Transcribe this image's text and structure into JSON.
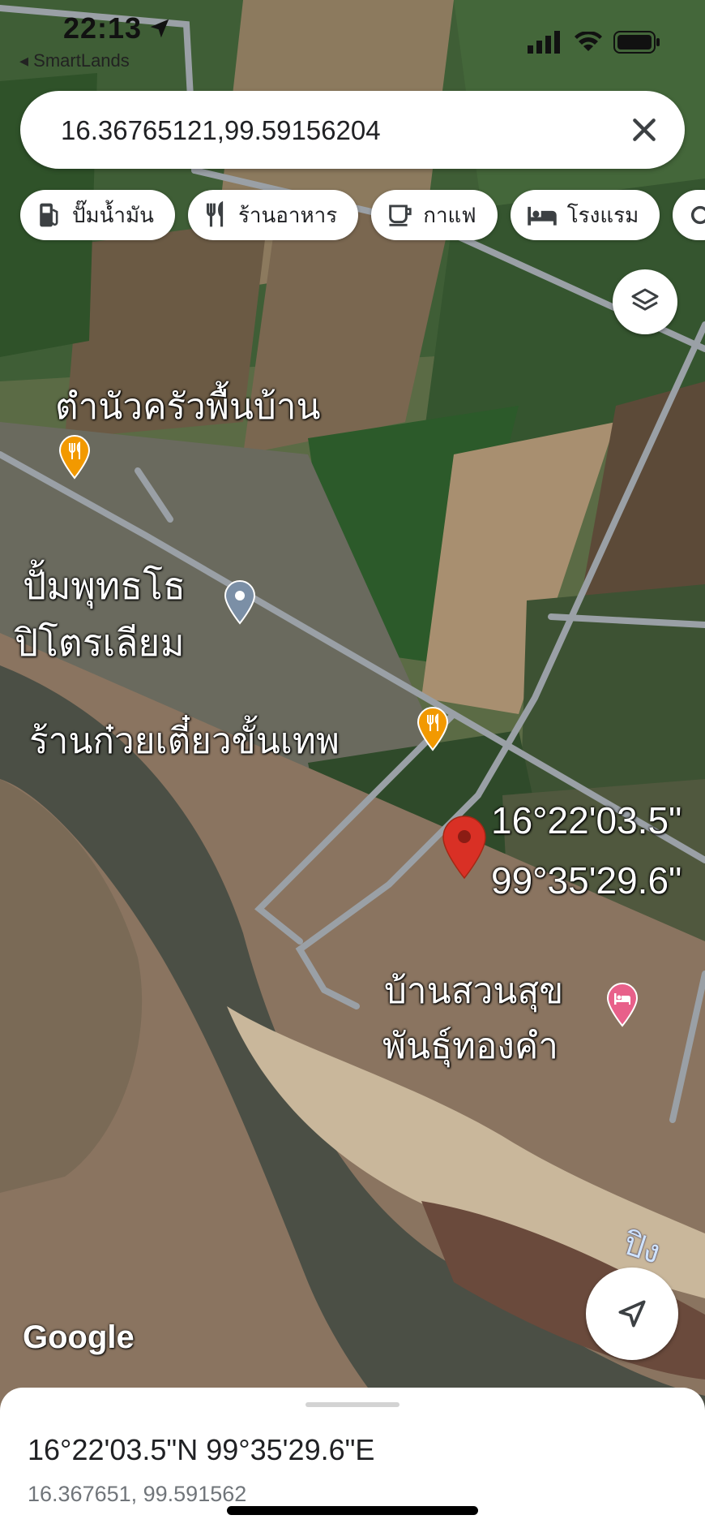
{
  "status_bar": {
    "time": "22:13",
    "back_app": "◂ SmartLands"
  },
  "search": {
    "value": "16.36765121,99.59156204"
  },
  "chips": [
    {
      "label": "ปั๊มน้ำมัน",
      "icon": "gas-station-icon"
    },
    {
      "label": "ร้านอาหาร",
      "icon": "restaurant-icon"
    },
    {
      "label": "กาแฟ",
      "icon": "coffee-icon"
    },
    {
      "label": "โรงแรม",
      "icon": "hotel-icon"
    }
  ],
  "places": {
    "restaurant1": "ตำนัวครัวพื้นบ้าน",
    "gas_station_line1": "ปั้มพุทธโธ",
    "gas_station_line2": "ปิโตรเลียม",
    "restaurant2": "ร้านก๋วยเตี๋ยวขั้นเทพ",
    "hotel_line1": "บ้านสวนสุข",
    "hotel_line2": "พันธุ์ทองคำ",
    "river": "ปิง"
  },
  "pin_label": {
    "lat": "16°22'03.5\"",
    "lng": "99°35'29.6\""
  },
  "attribution": "Google",
  "bottom_sheet": {
    "dms": "16°22'03.5\"N 99°35'29.6\"E",
    "decimal": "16.367651, 99.591562"
  },
  "colors": {
    "pin": "#d93025",
    "restaurant_pin": "#f29900",
    "gas_pin": "#7b8fa6",
    "hotel_pin": "#e8608a"
  }
}
